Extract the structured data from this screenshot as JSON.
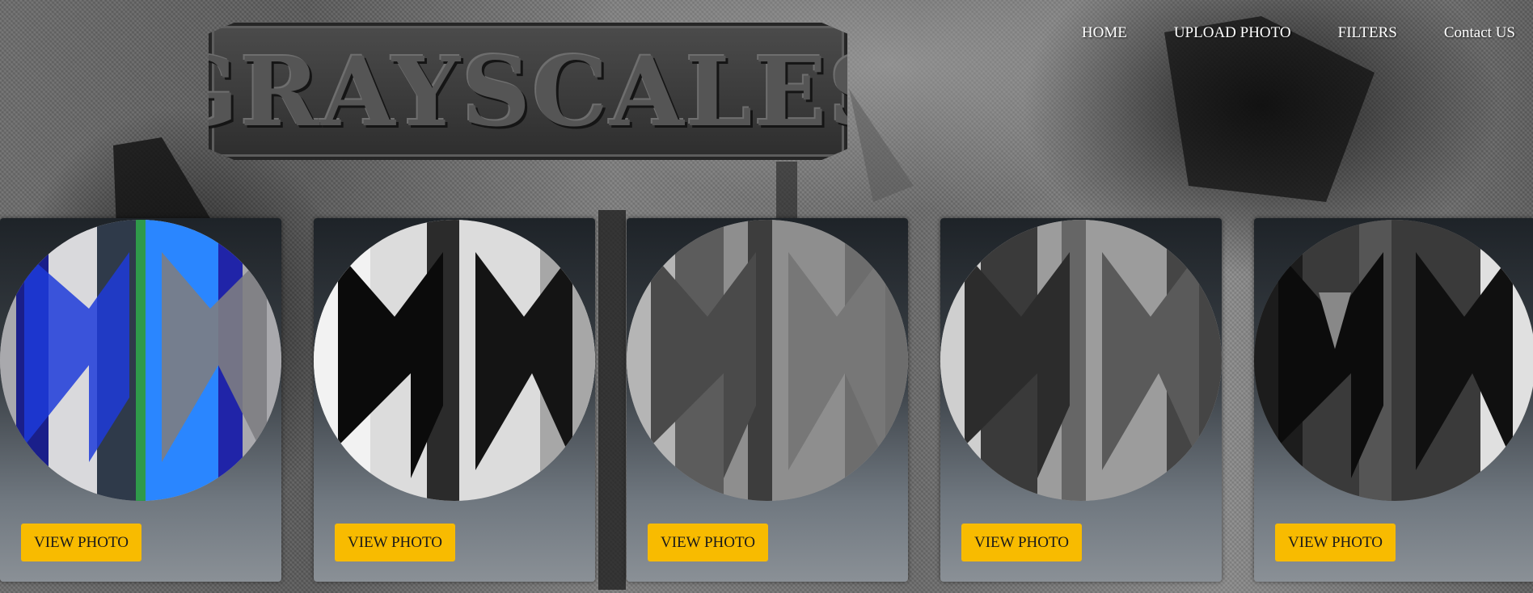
{
  "header": {
    "logo_text": "GRAYSCALES"
  },
  "nav": {
    "items": [
      {
        "label": "HOME"
      },
      {
        "label": "UPLOAD PHOTO"
      },
      {
        "label": "FILTERS"
      },
      {
        "label": "Contact US"
      }
    ]
  },
  "gallery": {
    "cards": [
      {
        "button_label": "VIEW PHOTO",
        "filter": "color"
      },
      {
        "button_label": "VIEW PHOTO",
        "filter": "high-contrast"
      },
      {
        "button_label": "VIEW PHOTO",
        "filter": "grayscale"
      },
      {
        "button_label": "VIEW PHOTO",
        "filter": "sepia-gray"
      },
      {
        "button_label": "VIEW PHOTO",
        "filter": "dark"
      }
    ]
  },
  "colors": {
    "button": "#f8bb00",
    "nav_text": "#ffffff"
  }
}
